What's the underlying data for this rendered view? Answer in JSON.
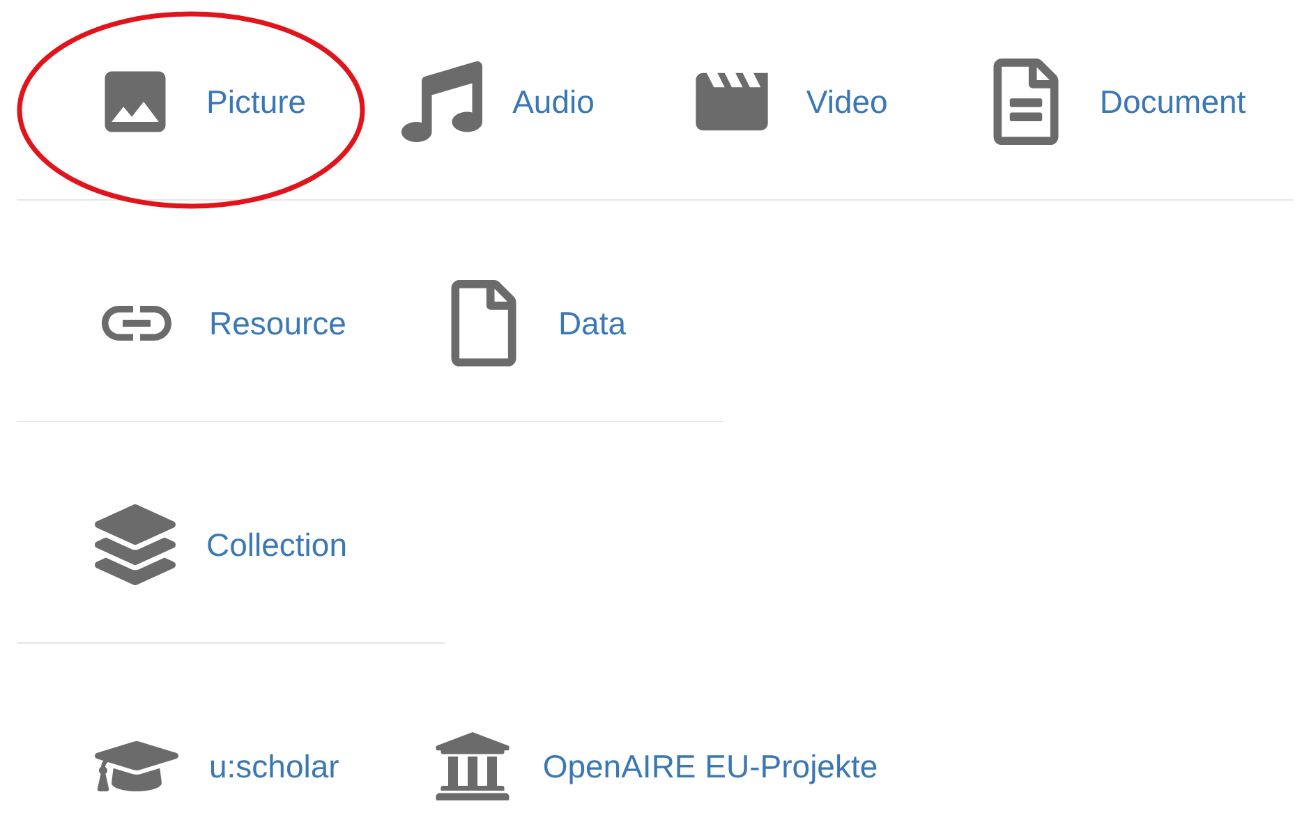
{
  "rows": [
    {
      "items": [
        {
          "kind": "picture",
          "label": "Picture",
          "circled": true
        },
        {
          "kind": "audio",
          "label": "Audio",
          "circled": false
        },
        {
          "kind": "video",
          "label": "Video",
          "circled": false
        },
        {
          "kind": "document",
          "label": "Document",
          "circled": false
        }
      ]
    },
    {
      "items": [
        {
          "kind": "resource",
          "label": "Resource",
          "circled": false
        },
        {
          "kind": "data",
          "label": "Data",
          "circled": false
        }
      ]
    },
    {
      "items": [
        {
          "kind": "collection",
          "label": "Collection",
          "circled": false
        }
      ]
    },
    {
      "items": [
        {
          "kind": "scholar",
          "label": "u:scholar",
          "circled": false
        },
        {
          "kind": "institution",
          "label": "OpenAIRE EU-Projekte",
          "circled": false
        }
      ]
    }
  ]
}
